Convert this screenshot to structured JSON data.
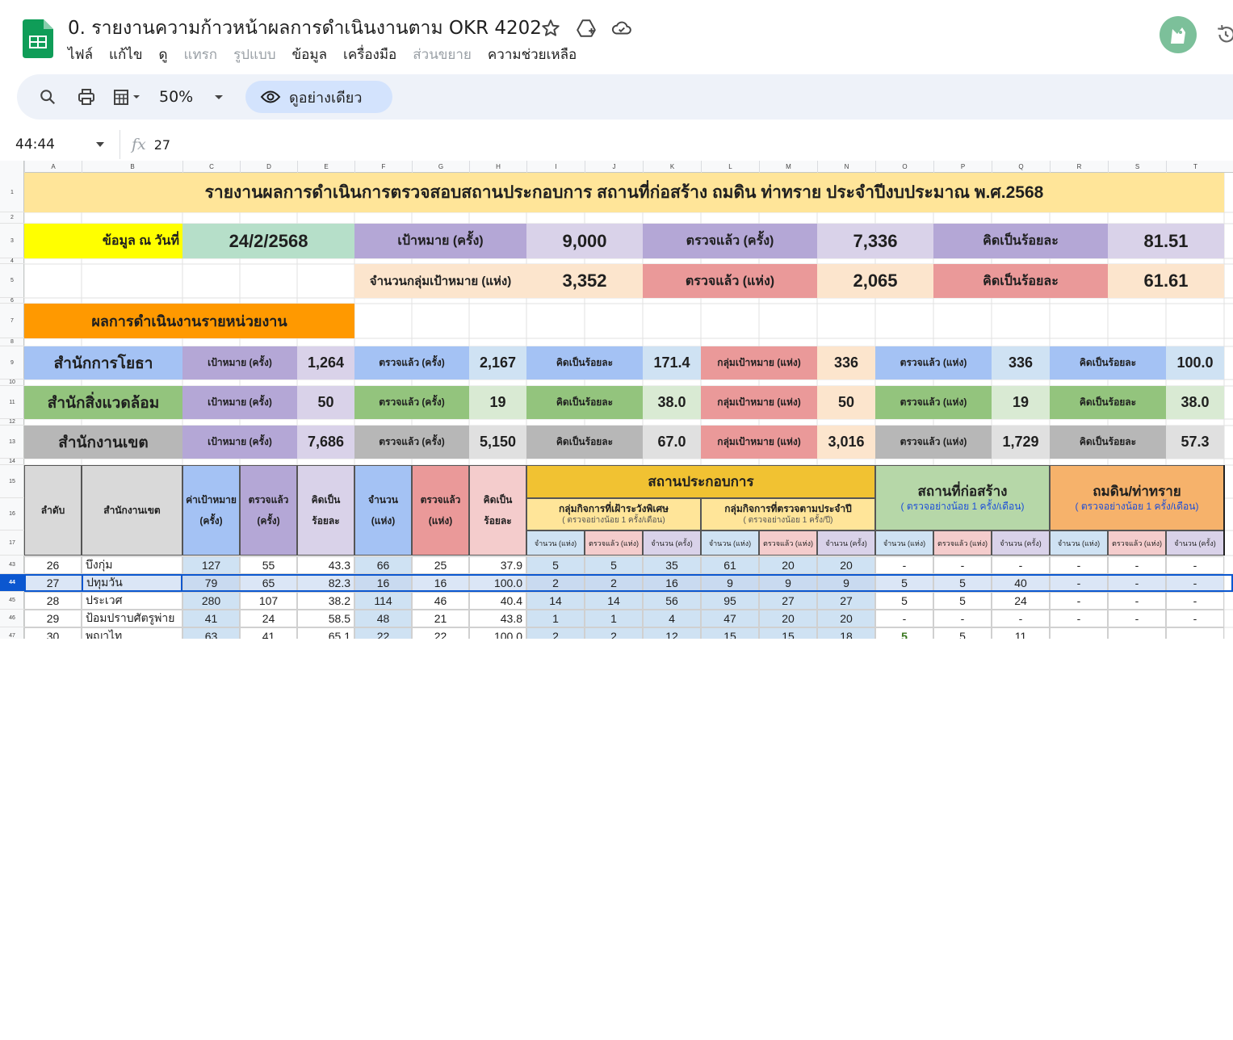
{
  "doc": {
    "title": "0. รายงานความก้าวหน้าผลการดำเนินงานตาม OKR 4202",
    "menu": [
      "ไฟล์",
      "แก้ไข",
      "ดู",
      "แทรก",
      "รูปแบบ",
      "ข้อมูล",
      "เครื่องมือ",
      "ส่วนขยาย",
      "ความช่วยเหลือ"
    ],
    "menu_disabled": [
      "แทรก",
      "รูปแบบ",
      "ส่วนขยาย"
    ]
  },
  "toolbar": {
    "zoom": "50%",
    "view_only": "ดูอย่างเดียว"
  },
  "formula": {
    "cell": "44:44",
    "value": "27"
  },
  "columns": [
    "A",
    "B",
    "C",
    "D",
    "E",
    "F",
    "G",
    "H",
    "I",
    "J",
    "K",
    "L",
    "M",
    "N",
    "O",
    "P",
    "Q",
    "R",
    "S",
    "T"
  ],
  "row_numbers": [
    "1",
    "2",
    "3",
    "4",
    "5",
    "6",
    "7",
    "8",
    "9",
    "10",
    "11",
    "12",
    "13",
    "14",
    "15",
    "16",
    "17",
    "43",
    "44",
    "45",
    "46",
    "47"
  ],
  "report": {
    "title": "รายงานผลการดำเนินการตรวจสอบสถานประกอบการ สถานที่ก่อสร้าง ถมดิน ท่าทราย ประจำปีงบประมาณ พ.ศ.2568",
    "date_label": "ข้อมูล ณ วันที่",
    "date": "24/2/2568",
    "target_label": "เป้าหมาย (ครั้ง)",
    "target": "9,000",
    "checked_label": "ตรวจแล้ว (ครั้ง)",
    "checked": "7,336",
    "pct_label": "คิดเป็นร้อยละ",
    "pct": "81.51",
    "group_label": "จำนวนกลุ่มเป้าหมาย (แห่ง)",
    "group": "3,352",
    "group_checked_label": "ตรวจแล้ว (แห่ง)",
    "group_checked": "2,065",
    "group_pct_label": "คิดเป็นร้อยละ",
    "group_pct": "61.61",
    "section_label": "ผลการดำเนินงานรายหน่วยงาน"
  },
  "units": [
    {
      "name": "สำนักการโยธา",
      "target_label": "เป้าหมาย (ครั้ง)",
      "target": "1,264",
      "checked_label": "ตรวจแล้ว (ครั้ง)",
      "checked": "2,167",
      "pct_label": "คิดเป็นร้อยละ",
      "pct": "171.4",
      "grp_label": "กลุ่มเป้าหมาย (แห่ง)",
      "grp": "336",
      "grp_checked_label": "ตรวจแล้ว (แห่ง)",
      "grp_checked": "336",
      "grp_pct_label": "คิดเป็นร้อยละ",
      "grp_pct": "100.0",
      "color": "#a4c2f4"
    },
    {
      "name": "สำนักสิ่งแวดล้อม",
      "target_label": "เป้าหมาย (ครั้ง)",
      "target": "50",
      "checked_label": "ตรวจแล้ว (ครั้ง)",
      "checked": "19",
      "pct_label": "คิดเป็นร้อยละ",
      "pct": "38.0",
      "grp_label": "กลุ่มเป้าหมาย (แห่ง)",
      "grp": "50",
      "grp_checked_label": "ตรวจแล้ว (แห่ง)",
      "grp_checked": "19",
      "grp_pct_label": "คิดเป็นร้อยละ",
      "grp_pct": "38.0",
      "color": "#93c47d"
    },
    {
      "name": "สำนักงานเขต",
      "target_label": "เป้าหมาย (ครั้ง)",
      "target": "7,686",
      "checked_label": "ตรวจแล้ว (ครั้ง)",
      "checked": "5,150",
      "pct_label": "คิดเป็นร้อยละ",
      "pct": "67.0",
      "grp_label": "กลุ่มเป้าหมาย (แห่ง)",
      "grp": "3,016",
      "grp_checked_label": "ตรวจแล้ว (แห่ง)",
      "grp_checked": "1,729",
      "grp_pct_label": "คิดเป็นร้อยละ",
      "grp_pct": "57.3",
      "color": "#b7b7b7"
    }
  ],
  "table_header": {
    "seq": "ลำดับ",
    "district": "สำนักงานเขต",
    "target": [
      "ค่าเป้าหมาย",
      "(ครั้ง)"
    ],
    "checked": [
      "ตรวจแล้ว",
      "(ครั้ง)"
    ],
    "pct": [
      "คิดเป็น",
      "ร้อยละ"
    ],
    "count": [
      "จำนวน",
      "(แห่ง)"
    ],
    "count_checked": [
      "ตรวจแล้ว",
      "(แห่ง)"
    ],
    "count_pct": [
      "คิดเป็น",
      "ร้อยละ"
    ],
    "business": "สถานประกอบการ",
    "special": "กลุ่มกิจการที่เฝ้าระวังพิเศษ",
    "special_note": "( ตรวจอย่างน้อย 1 ครั้ง/เดือน)",
    "annual": "กลุ่มกิจการที่ตรวจตามประจำปี",
    "annual_note": "( ตรวจอย่างน้อย 1 ครั้ง/ปี)",
    "construction": "สถานที่ก่อสร้าง",
    "construction_note": "( ตรวจอย่างน้อย 1 ครั้ง/เดือน)",
    "landfill": "ถมดิน/ท่าทราย",
    "landfill_note": "( ตรวจอย่างน้อย 1 ครั้ง/เดือน)",
    "sub": [
      "จำนวน (แห่ง)",
      "ตรวจแล้ว (แห่ง)",
      "จำนวน (ครั้ง)"
    ]
  },
  "rows": [
    [
      "26",
      "บึงกุ่ม",
      "127",
      "55",
      "43.3",
      "66",
      "25",
      "37.9",
      "5",
      "5",
      "35",
      "61",
      "20",
      "20",
      "-",
      "-",
      "-",
      "-",
      "-",
      "-"
    ],
    [
      "27",
      "ปทุมวัน",
      "79",
      "65",
      "82.3",
      "16",
      "16",
      "100.0",
      "2",
      "2",
      "16",
      "9",
      "9",
      "9",
      "5",
      "5",
      "40",
      "-",
      "-",
      "-"
    ],
    [
      "28",
      "ประเวศ",
      "280",
      "107",
      "38.2",
      "114",
      "46",
      "40.4",
      "14",
      "14",
      "56",
      "95",
      "27",
      "27",
      "5",
      "5",
      "24",
      "-",
      "-",
      "-"
    ],
    [
      "29",
      "ป้อมปราบศัตรูพ่าย",
      "41",
      "24",
      "58.5",
      "48",
      "21",
      "43.8",
      "1",
      "1",
      "4",
      "47",
      "20",
      "20",
      "-",
      "-",
      "-",
      "-",
      "-",
      "-"
    ],
    [
      "30",
      "พญาไท",
      "63",
      "41",
      "65.1",
      "22",
      "22",
      "100.0",
      "2",
      "2",
      "12",
      "15",
      "15",
      "18",
      "5",
      "5",
      "11",
      "",
      "",
      ""
    ]
  ],
  "colors": {
    "title_bg": "#ffe599",
    "date_bg": "#ffff00",
    "date_val_bg": "#b6dfc9",
    "purple": "#b4a7d6",
    "purple_light": "#d9d2e9",
    "peach": "#fce5cd",
    "red": "#ea9999",
    "red_light": "#f4cccc",
    "blue": "#a4c2f4",
    "blue_light": "#cfe2f3",
    "orange": "#ff9900",
    "gold": "#f1c232",
    "yellow_light": "#ffe599",
    "green": "#b6d7a8",
    "tan": "#f6b26b",
    "gray": "#d9d9d9",
    "selected": "#dbe6f6"
  }
}
